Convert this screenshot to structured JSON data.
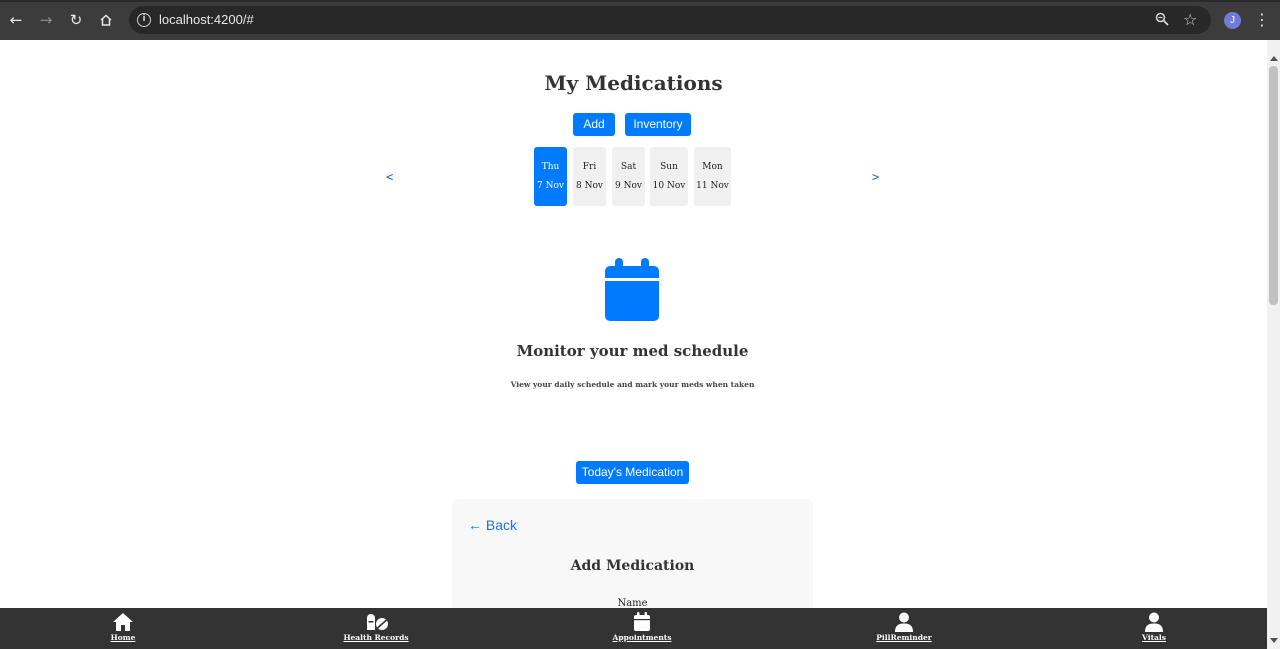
{
  "browser": {
    "url": "localhost:4200/#",
    "profile_initial": "J"
  },
  "page": {
    "title": "My Medications",
    "buttons": {
      "add": "Add",
      "inventory": "Inventory",
      "today": "Today's Medication"
    },
    "prev_label": "<",
    "next_label": ">",
    "days": [
      {
        "name": "Thu",
        "date": "7 Nov",
        "active": true
      },
      {
        "name": "Fri",
        "date": "8 Nov",
        "active": false
      },
      {
        "name": "Sat",
        "date": "9 Nov",
        "active": false
      },
      {
        "name": "Sun",
        "date": "10 Nov",
        "active": false
      },
      {
        "name": "Mon",
        "date": "11 Nov",
        "active": false
      }
    ],
    "empty_state": {
      "icon": "calendar-icon",
      "title": "Monitor your med schedule",
      "description": "View your daily schedule and mark your meds when taken"
    },
    "form": {
      "back_label": "← Back",
      "title": "Add Medication",
      "name_label": "Name"
    }
  },
  "bottom_nav": [
    {
      "label": "Home",
      "icon": "home-icon"
    },
    {
      "label": "Health Records",
      "icon": "pills-icon"
    },
    {
      "label": "Appointments",
      "icon": "calendar-icon"
    },
    {
      "label": "PillReminder",
      "icon": "user-icon"
    },
    {
      "label": "Vitals",
      "icon": "user-icon"
    }
  ],
  "colors": {
    "primary": "#007bff",
    "nav_bg": "#333333",
    "chrome_bg": "#3c3c3c"
  }
}
